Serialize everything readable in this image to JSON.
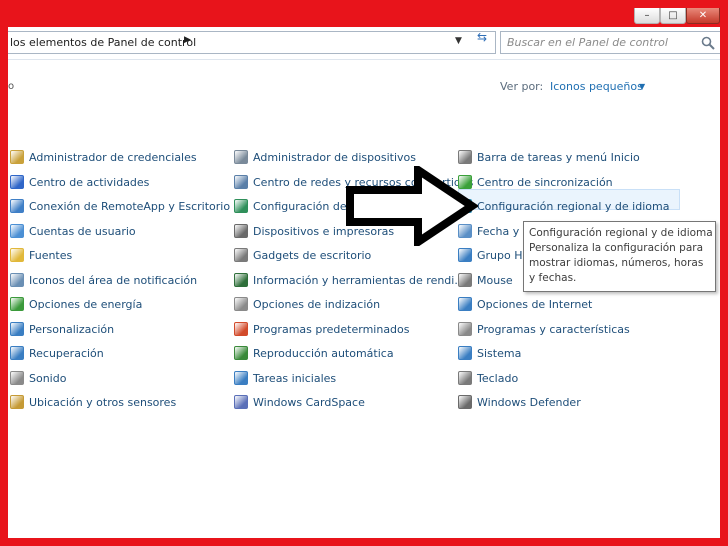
{
  "address": {
    "breadcrumb": "los elementos de Panel de control",
    "search_placeholder": "Buscar en el Panel de control"
  },
  "window_buttons": {
    "minimize": "–",
    "maximize": "□",
    "close": "✕"
  },
  "view": {
    "label": "Ver por:",
    "value": "Iconos pequeños"
  },
  "columns": [
    {
      "items": [
        {
          "label": "Administrador de credenciales",
          "icon": "credential-vault-icon",
          "color": "#c9a13b"
        },
        {
          "label": "Centro de actividades",
          "icon": "flag-icon",
          "color": "#2f66c8"
        },
        {
          "label": "Conexión de RemoteApp y Escritorio",
          "icon": "remote-desktop-icon",
          "color": "#3f7fc6"
        },
        {
          "label": "Cuentas de usuario",
          "icon": "users-icon",
          "color": "#4b8fd4"
        },
        {
          "label": "Fuentes",
          "icon": "fonts-folder-icon",
          "color": "#e1b83a"
        },
        {
          "label": "Iconos del área de notificación",
          "icon": "tray-icon",
          "color": "#6a8fb4"
        },
        {
          "label": "Opciones de energía",
          "icon": "power-icon",
          "color": "#3b9a3b"
        },
        {
          "label": "Personalización",
          "icon": "monitor-icon",
          "color": "#3a7ec2"
        },
        {
          "label": "Recuperación",
          "icon": "recovery-icon",
          "color": "#3a7ec2"
        },
        {
          "label": "Sonido",
          "icon": "speaker-icon",
          "color": "#8a8a8a"
        },
        {
          "label": "Ubicación y otros sensores",
          "icon": "sensor-icon",
          "color": "#c59a35"
        }
      ]
    },
    {
      "items": [
        {
          "label": "Administrador de dispositivos",
          "icon": "device-manager-icon",
          "color": "#7a8a9a"
        },
        {
          "label": "Centro de redes y recursos compartidos",
          "icon": "network-icon",
          "color": "#5a7fa8"
        },
        {
          "label": "Configuración de idioma de Windo...",
          "icon": "globe-icon",
          "color": "#2f8f5a"
        },
        {
          "label": "Dispositivos e impresoras",
          "icon": "printer-icon",
          "color": "#6a6a6a"
        },
        {
          "label": "Gadgets de escritorio",
          "icon": "gadget-icon",
          "color": "#7a7a7a"
        },
        {
          "label": "Información y herramientas de rendi...",
          "icon": "performance-icon",
          "color": "#2f6f3a"
        },
        {
          "label": "Opciones de indización",
          "icon": "search-index-icon",
          "color": "#8a8a8a"
        },
        {
          "label": "Programas predeterminados",
          "icon": "default-programs-icon",
          "color": "#d24a2a"
        },
        {
          "label": "Reproducción automática",
          "icon": "autoplay-icon",
          "color": "#3a8a3a"
        },
        {
          "label": "Tareas iniciales",
          "icon": "getting-started-icon",
          "color": "#3a7ec2"
        },
        {
          "label": "Windows CardSpace",
          "icon": "cardspace-icon",
          "color": "#5a6fb8"
        }
      ]
    },
    {
      "items": [
        {
          "label": "Barra de tareas y menú Inicio",
          "icon": "taskbar-icon",
          "color": "#7a7a7a"
        },
        {
          "label": "Centro de sincronización",
          "icon": "sync-icon",
          "color": "#3aa03a"
        },
        {
          "label": "Configuración regional y de idioma",
          "icon": "region-globe-icon",
          "color": "#2f8fb8"
        },
        {
          "label": "Fecha y hora",
          "icon": "clock-icon",
          "color": "#5a8fc6"
        },
        {
          "label": "Grupo Hogar",
          "icon": "homegroup-icon",
          "color": "#3a7ec2"
        },
        {
          "label": "Mouse",
          "icon": "mouse-icon",
          "color": "#7a7a7a"
        },
        {
          "label": "Opciones de Internet",
          "icon": "internet-options-icon",
          "color": "#3a7ec2"
        },
        {
          "label": "Programas y características",
          "icon": "programs-icon",
          "color": "#8a8a8a"
        },
        {
          "label": "Sistema",
          "icon": "system-icon",
          "color": "#3a7ec2"
        },
        {
          "label": "Teclado",
          "icon": "keyboard-icon",
          "color": "#7a7a7a"
        },
        {
          "label": "Windows Defender",
          "icon": "defender-icon",
          "color": "#6a6a6a"
        }
      ]
    }
  ],
  "tooltip": {
    "title": "Configuración regional y de idioma",
    "description": "Personaliza la configuración para mostrar idiomas, números, horas y fechas."
  },
  "accent_color": "#e8141b"
}
